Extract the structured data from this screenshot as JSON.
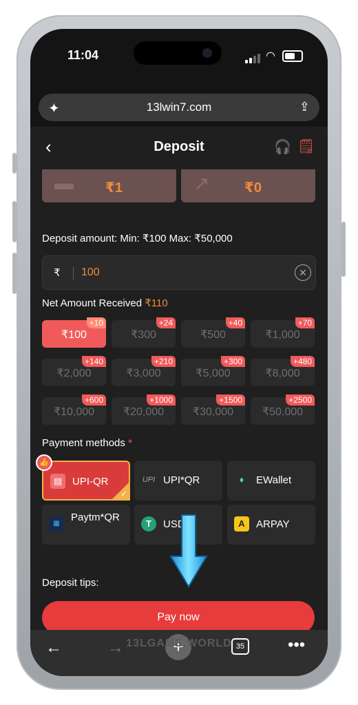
{
  "status": {
    "time": "11:04"
  },
  "browser": {
    "url": "13lwin7.com",
    "tabs_count": "35",
    "watermark": "13LGAME.WORLD"
  },
  "header": {
    "title": "Deposit"
  },
  "wallets": [
    {
      "amount": "₹1"
    },
    {
      "amount": "₹0"
    }
  ],
  "deposit": {
    "limits_label": "Deposit amount: Min: ₹100 Max: ₹50,000",
    "currency_symbol": "₹",
    "input_value": "100",
    "net_label": "Net Amount Received",
    "net_value": "₹110"
  },
  "amounts": [
    {
      "value": "₹100",
      "bonus": "+10",
      "selected": true
    },
    {
      "value": "₹300",
      "bonus": "+24"
    },
    {
      "value": "₹500",
      "bonus": "+40"
    },
    {
      "value": "₹1,000",
      "bonus": "+70"
    },
    {
      "value": "₹2,000",
      "bonus": "+140"
    },
    {
      "value": "₹3,000",
      "bonus": "+210"
    },
    {
      "value": "₹5,000",
      "bonus": "+300"
    },
    {
      "value": "₹8,000",
      "bonus": "+480"
    },
    {
      "value": "₹10,000",
      "bonus": "+600"
    },
    {
      "value": "₹20,000",
      "bonus": "+1000"
    },
    {
      "value": "₹30,000",
      "bonus": "+1500"
    },
    {
      "value": "₹50,000",
      "bonus": "+2500"
    }
  ],
  "payment": {
    "label": "Payment methods",
    "required_mark": "*",
    "methods": [
      {
        "name": "UPI-QR",
        "selected": true
      },
      {
        "name": "UPI*QR"
      },
      {
        "name": "EWallet"
      },
      {
        "name": "Paytm*QR"
      },
      {
        "name": "USDT"
      },
      {
        "name": "ARPAY"
      }
    ]
  },
  "tips_label": "Deposit tips:",
  "pay_button": "Pay now",
  "colors": {
    "accent": "#e83b3b",
    "highlight": "#f08d3a",
    "background": "#1f1f1f"
  }
}
